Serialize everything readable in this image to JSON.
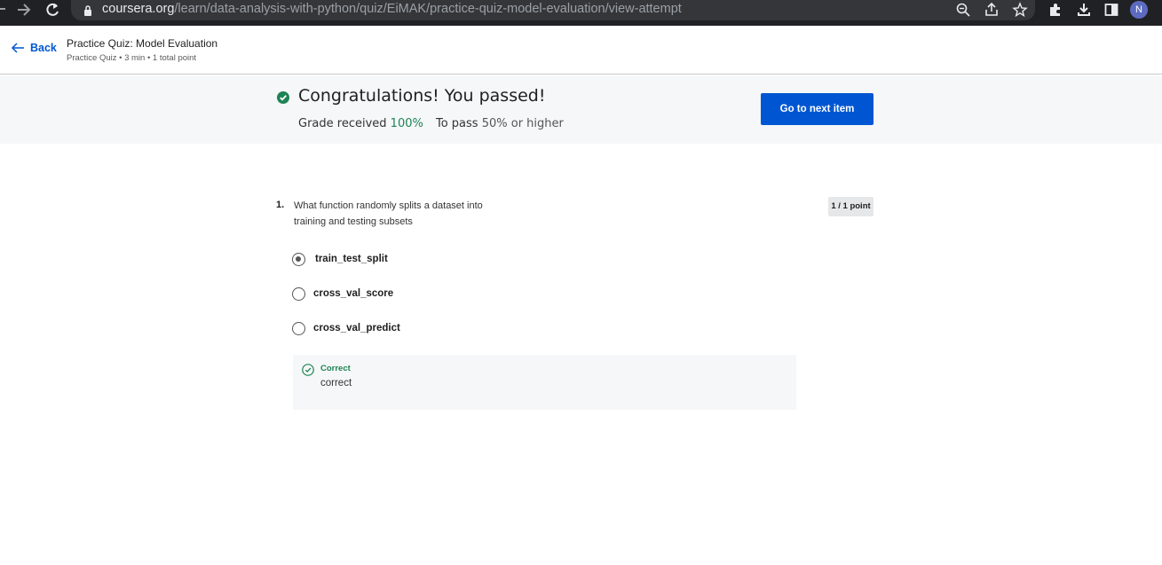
{
  "browser": {
    "url_host": "coursera.org",
    "url_path": "/learn/data-analysis-with-python/quiz/EiMAK/practice-quiz-model-evaluation/view-attempt",
    "avatar_letter": "N"
  },
  "header": {
    "back_label": "Back",
    "title": "Practice Quiz: Model Evaluation",
    "meta": "Practice Quiz • 3 min • 1 total point"
  },
  "banner": {
    "headline": "Congratulations! You passed!",
    "grade_label": "Grade received",
    "grade_value": "100%",
    "pass_label": "To pass",
    "pass_value": "50% or higher",
    "next_button": "Go to next item"
  },
  "question": {
    "number": "1.",
    "text": "What function randomly splits a dataset into training and testing subsets",
    "points": "1 / 1 point",
    "options": [
      {
        "label": "train_test_split",
        "selected": true
      },
      {
        "label": "cross_val_score",
        "selected": false
      },
      {
        "label": "cross_val_predict",
        "selected": false
      }
    ],
    "feedback": {
      "status": "Correct",
      "text": "correct"
    }
  },
  "colors": {
    "accent": "#0056d2",
    "success": "#1f8354"
  }
}
